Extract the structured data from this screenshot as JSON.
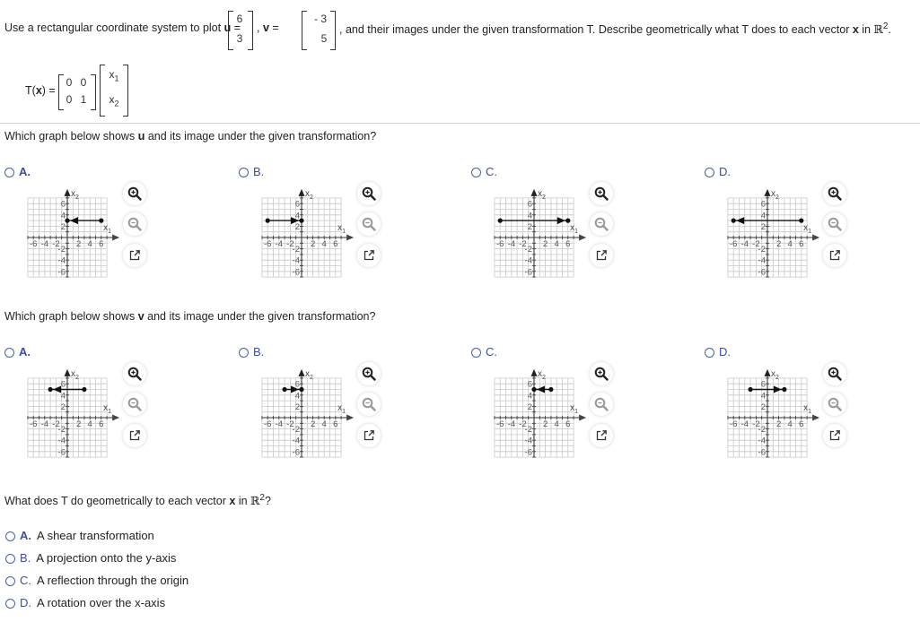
{
  "problem": {
    "intro_prefix": "Use a rectangular coordinate system to plot",
    "u_label": "u",
    "v_label": "v",
    "u_vector": [
      "6",
      "3"
    ],
    "v_vector": [
      "- 3",
      "5"
    ],
    "intro_suffix": ", and their images under the given transformation T. Describe geometrically what T does to each vector",
    "x_label": "x",
    "in_text": "in",
    "r2": "ℝ",
    "r2_exp": "2",
    "period": ".",
    "transform_lhs_T": "T(",
    "transform_lhs_x": "x",
    "transform_lhs_end": ") =",
    "matrix": [
      [
        "0",
        "0"
      ],
      [
        "0",
        "1"
      ]
    ],
    "vector_entries": [
      "x",
      "x"
    ],
    "vector_subs": [
      "1",
      "2"
    ]
  },
  "question_u": {
    "prefix": "Which graph below shows",
    "bold": "u",
    "suffix": "and its image under the given transformation?"
  },
  "question_v": {
    "prefix": "Which graph below shows",
    "bold": "v",
    "suffix": "and its image under the given transformation?"
  },
  "graph_options_u": [
    {
      "label": "A.",
      "from": [
        6,
        3
      ],
      "to": [
        0,
        3
      ]
    },
    {
      "label": "B.",
      "from": [
        -6,
        3
      ],
      "to": [
        0,
        3
      ]
    },
    {
      "label": "C.",
      "from": [
        -6,
        3
      ],
      "to": [
        6,
        3
      ]
    },
    {
      "label": "D.",
      "from": [
        6,
        3
      ],
      "to": [
        -6,
        3
      ]
    }
  ],
  "graph_options_v": [
    {
      "label": "A.",
      "from": [
        3,
        5
      ],
      "to": [
        -3,
        5
      ]
    },
    {
      "label": "B.",
      "from": [
        -3,
        5
      ],
      "to": [
        0,
        5
      ]
    },
    {
      "label": "C.",
      "from": [
        3,
        5
      ],
      "to": [
        0,
        5
      ]
    },
    {
      "label": "D.",
      "from": [
        -3,
        5
      ],
      "to": [
        3,
        5
      ]
    }
  ],
  "graph_axes": {
    "x_label": "x",
    "x_sub": "1",
    "y_label": "x",
    "y_sub": "2",
    "x_ticks": [
      "-6",
      "-4",
      "-2",
      "2",
      "4",
      "6"
    ],
    "y_ticks": [
      "6",
      "4",
      "2",
      "-2",
      "-4",
      "-6"
    ],
    "range": [
      -7,
      7
    ]
  },
  "icons": {
    "zoom_in": "zoom-in-icon",
    "zoom_out": "zoom-out-icon",
    "popout": "popout-icon"
  },
  "question_geo": {
    "prefix": "What does T do geometrically to each vector",
    "bold": "x",
    "in_text": "in",
    "r2": "ℝ",
    "r2_exp": "2",
    "suffix": "?"
  },
  "answers": [
    {
      "label": "A.",
      "text": "A shear transformation"
    },
    {
      "label": "B.",
      "text": "A projection onto the y-axis"
    },
    {
      "label": "C.",
      "text": "A reflection through the origin"
    },
    {
      "label": "D.",
      "text": "A rotation over the x-axis"
    }
  ],
  "colors": {
    "accent": "#3b4fa0",
    "text": "#222222",
    "grid": "#c8c8c8",
    "axis": "#333333"
  }
}
